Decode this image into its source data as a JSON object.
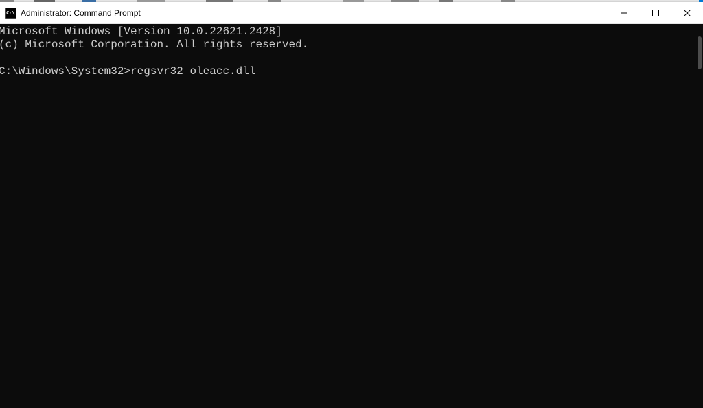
{
  "window": {
    "title": "Administrator: Command Prompt"
  },
  "terminal": {
    "line1": "Microsoft Windows [Version 10.0.22621.2428]",
    "line2": "(c) Microsoft Corporation. All rights reserved.",
    "blank": "",
    "prompt": "C:\\Windows\\System32>",
    "command": "regsvr32 oleacc.dll"
  }
}
